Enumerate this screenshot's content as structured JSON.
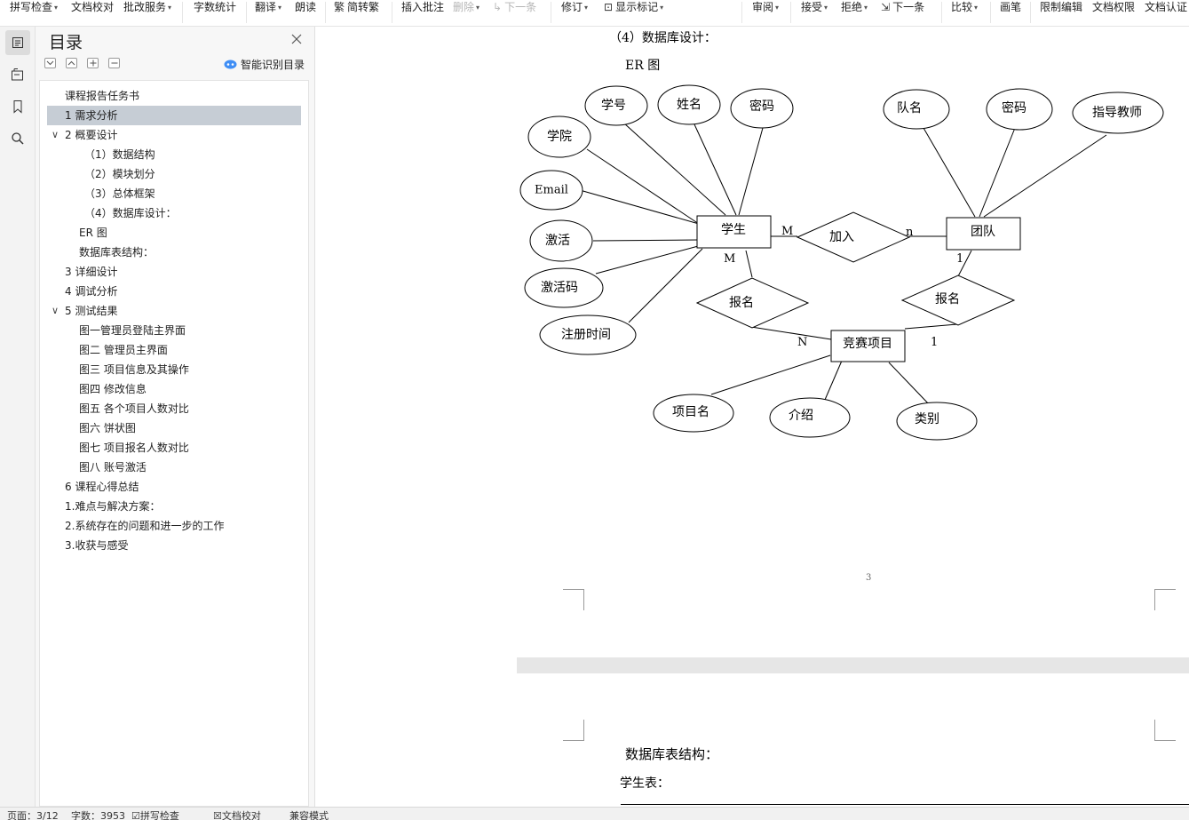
{
  "ribbon": {
    "spell_check": "拼写检查",
    "doc_proofread": "文档校对",
    "batch_edit": "批改服务",
    "word_count": "字数统计",
    "translate": "翻译",
    "read_aloud": "朗读",
    "convert_chinese": "简转繁",
    "insert_comment": "插入批注",
    "delete": "删除",
    "next_comment": "下一条",
    "track_changes": "修订",
    "show_markup": "显示标记",
    "review": "审阅",
    "accept": "接受",
    "reject": "拒绝",
    "next_change": "下一条",
    "compare": "比较",
    "ink": "画笔",
    "restrict_edit": "限制编辑",
    "doc_permission": "文档权限",
    "doc_certify": "文档认证"
  },
  "toc": {
    "title": "目录",
    "smart_label": "智能识别目录",
    "items": [
      {
        "text": "课程报告任务书"
      },
      {
        "text": "1  需求分析"
      },
      {
        "text": "2  概要设计"
      },
      {
        "text": "（1）数据结构"
      },
      {
        "text": "（2）模块划分"
      },
      {
        "text": "（3）总体框架"
      },
      {
        "text": "（4）数据库设计："
      },
      {
        "text": "ER 图"
      },
      {
        "text": "数据库表结构："
      },
      {
        "text": "3  详细设计"
      },
      {
        "text": "4  调试分析"
      },
      {
        "text": "5    测试结果"
      },
      {
        "text": "图一管理员登陆主界面"
      },
      {
        "text": "图二  管理员主界面"
      },
      {
        "text": "图三  项目信息及其操作"
      },
      {
        "text": "图四  修改信息"
      },
      {
        "text": "图五  各个项目人数对比"
      },
      {
        "text": "图六  饼状图"
      },
      {
        "text": "图七  项目报名人数对比"
      },
      {
        "text": "图八  账号激活"
      },
      {
        "text": "6  课程心得总结"
      },
      {
        "text": "1.难点与解决方案："
      },
      {
        "text": "2.系统存在的问题和进一步的工作"
      },
      {
        "text": "3.收获与感受"
      }
    ]
  },
  "document": {
    "heading": "（4）数据库设计：",
    "er_label": "ER 图",
    "page_number": "3",
    "db_structure": "数据库表结构：",
    "student_table": "学生表："
  },
  "er": {
    "entities": {
      "student": "学生",
      "team": "团队",
      "project": "竞赛项目"
    },
    "relations": {
      "join": "加入",
      "signup_student": "报名",
      "signup_team": "报名"
    },
    "student_attrs": {
      "college": "学院",
      "sid": "学号",
      "name": "姓名",
      "password": "密码",
      "email": "Email",
      "activate": "激活",
      "activation_code": "激活码",
      "reg_time": "注册时间"
    },
    "team_attrs": {
      "team_name": "队名",
      "password": "密码",
      "advisor": "指导教师"
    },
    "project_attrs": {
      "project_name": "项目名",
      "intro": "介绍",
      "category": "类别"
    },
    "cardinalities": {
      "student_join": "M",
      "join_team": "n",
      "team_signup": "1",
      "student_signup": "M",
      "signup_project_n": "N",
      "signup_project_1": "1"
    }
  },
  "status": {
    "page": "页面：3/12",
    "words": "字数：3953",
    "spell": "拼写检查",
    "proof": "文档校对",
    "compat": "兼容模式"
  }
}
